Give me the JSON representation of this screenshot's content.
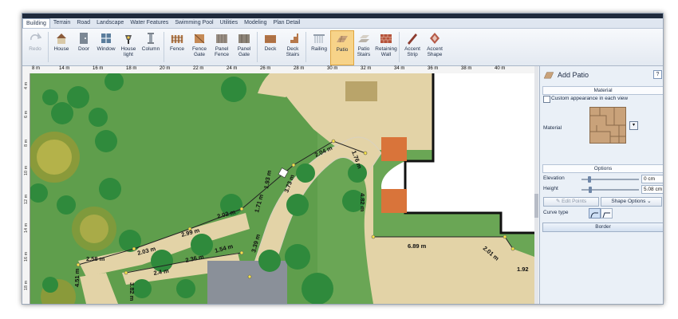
{
  "tabs": [
    "Building",
    "Terrain",
    "Road",
    "Landscape",
    "Water Features",
    "Swimming Pool",
    "Utilities",
    "Modeling",
    "Plan Detail"
  ],
  "tools": [
    {
      "label": "Redo",
      "icon": "redo-icon",
      "disabled": true
    },
    {
      "label": "House",
      "icon": "house-icon"
    },
    {
      "label": "Door",
      "icon": "door-icon"
    },
    {
      "label": "Window",
      "icon": "window-icon"
    },
    {
      "label": "House light",
      "icon": "house-light-icon"
    },
    {
      "label": "Column",
      "icon": "column-icon"
    },
    {
      "label": "Fence",
      "icon": "fence-icon"
    },
    {
      "label": "Fence Gate",
      "icon": "fence-gate-icon"
    },
    {
      "label": "Panel Fence",
      "icon": "panel-fence-icon"
    },
    {
      "label": "Panel Gate",
      "icon": "panel-gate-icon"
    },
    {
      "label": "Deck",
      "icon": "deck-icon"
    },
    {
      "label": "Deck Stairs",
      "icon": "deck-stairs-icon"
    },
    {
      "label": "Railing",
      "icon": "railing-icon"
    },
    {
      "label": "Patio",
      "icon": "patio-icon",
      "active": true
    },
    {
      "label": "Patio Stairs",
      "icon": "patio-stairs-icon"
    },
    {
      "label": "Retaining Wall",
      "icon": "retaining-wall-icon"
    },
    {
      "label": "Accent Strip",
      "icon": "accent-strip-icon"
    },
    {
      "label": "Accent Shape",
      "icon": "accent-shape-icon"
    }
  ],
  "ruler_top": [
    "8 m",
    "14 m",
    "16 m",
    "18 m",
    "20 m",
    "22 m",
    "24 m",
    "26 m",
    "28 m",
    "30 m",
    "32 m",
    "34 m",
    "36 m",
    "38 m",
    "40 m"
  ],
  "ruler_left": [
    "4 m",
    "6 m",
    "8 m",
    "10 m",
    "12 m",
    "14 m",
    "16 m",
    "18 m"
  ],
  "measurements": [
    "1.76 m",
    "2.04 m",
    "3.73 m",
    "1.93 m",
    "1.71 m",
    "4.82 m",
    "2.02 m",
    "2.99 m",
    "2.03 m",
    "2.58 m",
    "2.36 m",
    "1.54 m",
    "3.39 m",
    "2.4 m",
    "6.89 m",
    "2.01 m",
    "1.92",
    "3.82 m",
    "4.51 m"
  ],
  "panel": {
    "title": "Add Patio",
    "material_header": "Material",
    "custom_appearance": "Custom appearance in each view",
    "material_label": "Material",
    "options_header": "Options",
    "elevation_label": "Elevation",
    "elevation_value": "0 cm",
    "height_label": "Height",
    "height_value": "5.08 cm",
    "edit_points": "Edit Points",
    "shape_options": "Shape Options",
    "curve_type_label": "Curve type",
    "border_label": "Border"
  },
  "colors": {
    "grass": "#5f9e4c",
    "paving": "#e3d3a7",
    "brick": "#d9743a",
    "water": "#8a9099",
    "accent": "#f7d389"
  }
}
